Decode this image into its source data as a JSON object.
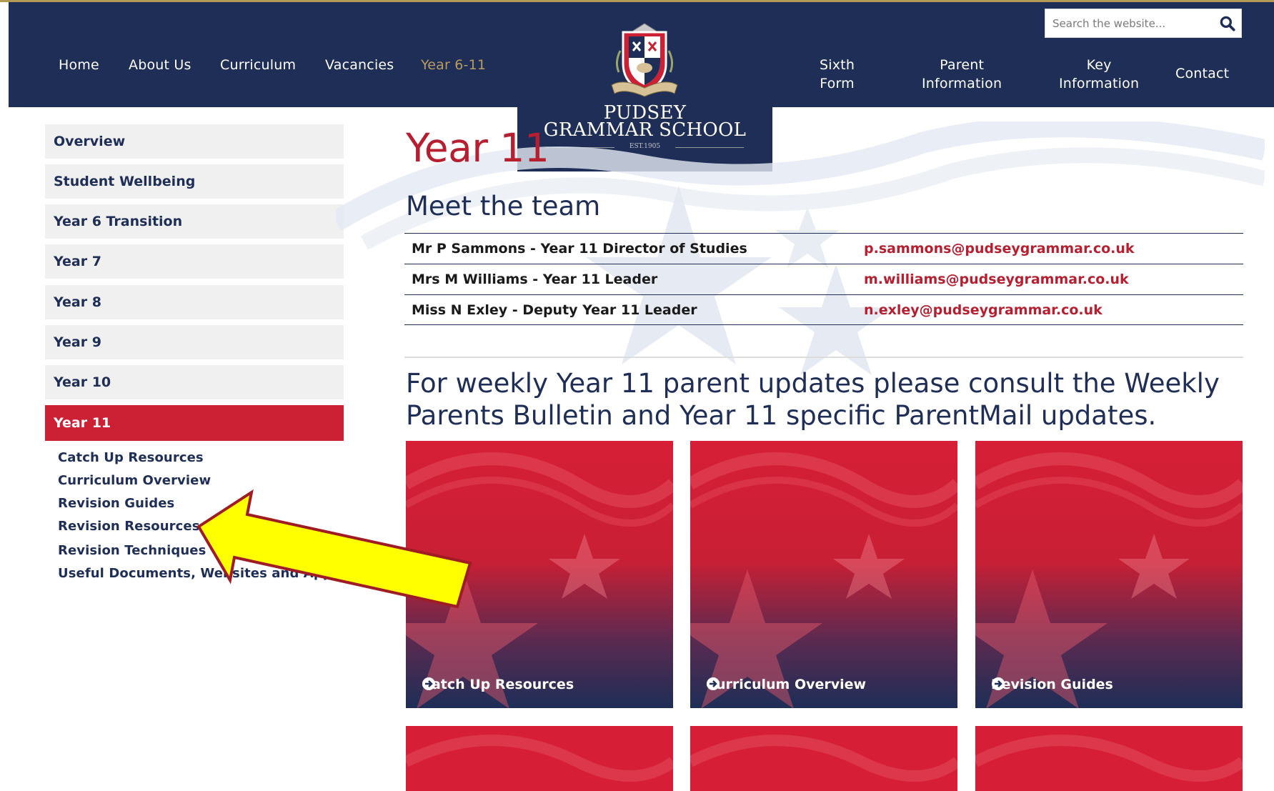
{
  "header": {
    "nav_left": [
      "Home",
      "About Us",
      "Curriculum",
      "Vacancies",
      "Year 6-11"
    ],
    "nav_right": {
      "sixth_form": [
        "Sixth",
        "Form"
      ],
      "parent_information": [
        "Parent",
        "Information"
      ],
      "key_information": [
        "Key",
        "Information"
      ],
      "contact": "Contact"
    },
    "search": {
      "placeholder": "Search the website..."
    },
    "logo": {
      "line1": "PUDSEY",
      "line2": "GRAMMAR SCHOOL",
      "est": "EST.1905"
    },
    "active_color": "#b89b5e",
    "background": "#1e2e57"
  },
  "sidebar": {
    "items": [
      "Overview",
      "Student Wellbeing",
      "Year 6 Transition",
      "Year 7",
      "Year 8",
      "Year 9",
      "Year 10",
      "Year 11"
    ],
    "active_index": 7,
    "sub_links": [
      "Catch Up Resources",
      "Curriculum Overview",
      "Revision Guides",
      "Revision Resources",
      "Revision Techniques",
      "Useful Documents, Websites and Apps"
    ]
  },
  "main": {
    "title": "Year 11",
    "team_heading": "Meet the team",
    "team": [
      {
        "name": "Mr P Sammons - Year 11 Director of Studies",
        "email": "p.sammons@pudseygrammar.co.uk"
      },
      {
        "name": "Mrs M Williams - Year 11 Leader",
        "email": "m.williams@pudseygrammar.co.uk"
      },
      {
        "name": "Miss N Exley - Deputy Year 11 Leader",
        "email": "n.exley@pudseygrammar.co.uk"
      }
    ],
    "updates_text": "For weekly Year 11 parent updates please consult the Weekly Parents Bulletin and Year 11 specific ParentMail updates.",
    "tiles": [
      "Catch Up Resources",
      "Curriculum Overview",
      "Revision Guides"
    ]
  },
  "colors": {
    "brand_navy": "#1e2e57",
    "brand_red": "#cc2035",
    "annotation_yellow": "#ffff00",
    "annotation_outline": "#a01c25"
  }
}
